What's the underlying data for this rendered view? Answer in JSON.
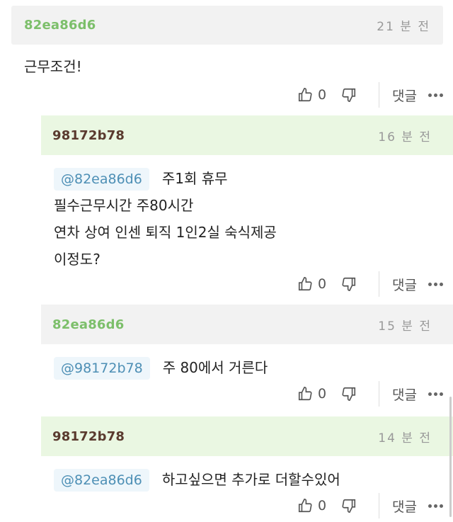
{
  "comments": [
    {
      "author": "82ea86d6",
      "time": "21 분 전",
      "mention": "",
      "lines": [
        "근무조건!"
      ],
      "likes": "0",
      "reply_label": "댓글"
    },
    {
      "author": "98172b78",
      "time": "16 분 전",
      "mention": "@82ea86d6",
      "lines": [
        "주1회 휴무",
        "필수근무시간 주80시간",
        "연차 상여 인센 퇴직 1인2실 숙식제공",
        "이정도?"
      ],
      "likes": "0",
      "reply_label": "댓글"
    },
    {
      "author": "82ea86d6",
      "time": "15 분 전",
      "mention": "@98172b78",
      "lines": [
        "주 80에서 거른다"
      ],
      "likes": "0",
      "reply_label": "댓글"
    },
    {
      "author": "98172b78",
      "time": "14 분 전",
      "mention": "@82ea86d6",
      "lines": [
        "하고싶으면 추가로 더할수있어"
      ],
      "likes": "0",
      "reply_label": "댓글"
    }
  ],
  "icons": {
    "like": "thumbs-up-icon",
    "dislike": "thumbs-down-icon",
    "more": "more-dots-icon"
  },
  "colors": {
    "reply_header": "#eaf7e2",
    "root_header": "#f2f2f2",
    "author_green": "#7cbf6a",
    "author_brown": "#5a3a2e",
    "mention": "#4d8fb5"
  }
}
